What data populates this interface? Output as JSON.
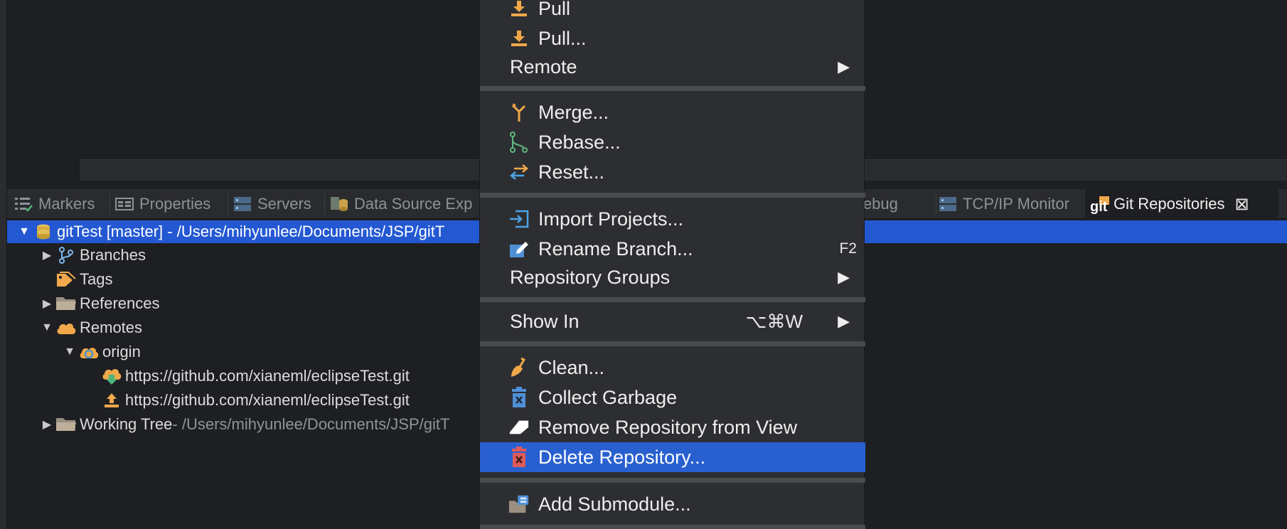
{
  "tabs": [
    {
      "label": "Markers",
      "icon": "markers-icon"
    },
    {
      "label": "Properties",
      "icon": "properties-icon"
    },
    {
      "label": "Servers",
      "icon": "servers-icon"
    },
    {
      "label": "Data Source Exp",
      "icon": "data-source-icon"
    },
    {
      "label": "Debug",
      "icon": "debug-icon"
    },
    {
      "label": "TCP/IP Monitor",
      "icon": "tcpip-monitor-icon"
    },
    {
      "label": "Git Repositories",
      "icon": "git-icon",
      "active": true
    }
  ],
  "tree": {
    "repo": {
      "label": "gitTest [master] - /Users/mihyunlee/Documents/JSP/gitT",
      "icon": "repository-icon"
    },
    "items": [
      {
        "label": "Branches",
        "icon": "branches-icon"
      },
      {
        "label": "Tags",
        "icon": "tags-icon"
      },
      {
        "label": "References",
        "icon": "folder-icon"
      },
      {
        "label": "Remotes",
        "icon": "cloud-icon"
      },
      {
        "label": "origin",
        "icon": "remote-origin-icon"
      },
      {
        "label": "https://github.com/xianeml/eclipseTest.git",
        "icon": "fetch-icon"
      },
      {
        "label": "https://github.com/xianeml/eclipseTest.git",
        "icon": "push-icon"
      },
      {
        "label": "Working Tree",
        "suffix": " - /Users/mihyunlee/Documents/JSP/gitT",
        "icon": "folder-icon"
      }
    ]
  },
  "menu": {
    "items": [
      {
        "label": "Pull",
        "icon": "pull-icon"
      },
      {
        "label": "Pull...",
        "icon": "pull-icon"
      },
      {
        "label": "Remote",
        "submenu": "▶"
      },
      {
        "label": "Merge...",
        "icon": "merge-icon"
      },
      {
        "label": "Rebase...",
        "icon": "rebase-icon"
      },
      {
        "label": "Reset...",
        "icon": "reset-icon"
      },
      {
        "label": "Import Projects...",
        "icon": "import-icon"
      },
      {
        "label": "Rename Branch...",
        "icon": "rename-icon",
        "shortcut": "F2"
      },
      {
        "label": "Repository Groups",
        "submenu": "▶"
      },
      {
        "label": "Show In",
        "shortcut": "⌥⌘W",
        "submenu": "▶"
      },
      {
        "label": "Clean...",
        "icon": "broom-icon"
      },
      {
        "label": "Collect Garbage",
        "icon": "trash-icon"
      },
      {
        "label": "Remove Repository from View",
        "icon": "eraser-icon"
      },
      {
        "label": "Delete Repository...",
        "icon": "delete-icon",
        "highlighted": true
      },
      {
        "label": "Add Submodule...",
        "icon": "submodule-icon"
      }
    ]
  },
  "colors": {
    "selection": "#2358d2",
    "menu_highlight": "#2860d0",
    "icon_orange": "#f0a84a",
    "menu_bg": "#2d2e31"
  }
}
